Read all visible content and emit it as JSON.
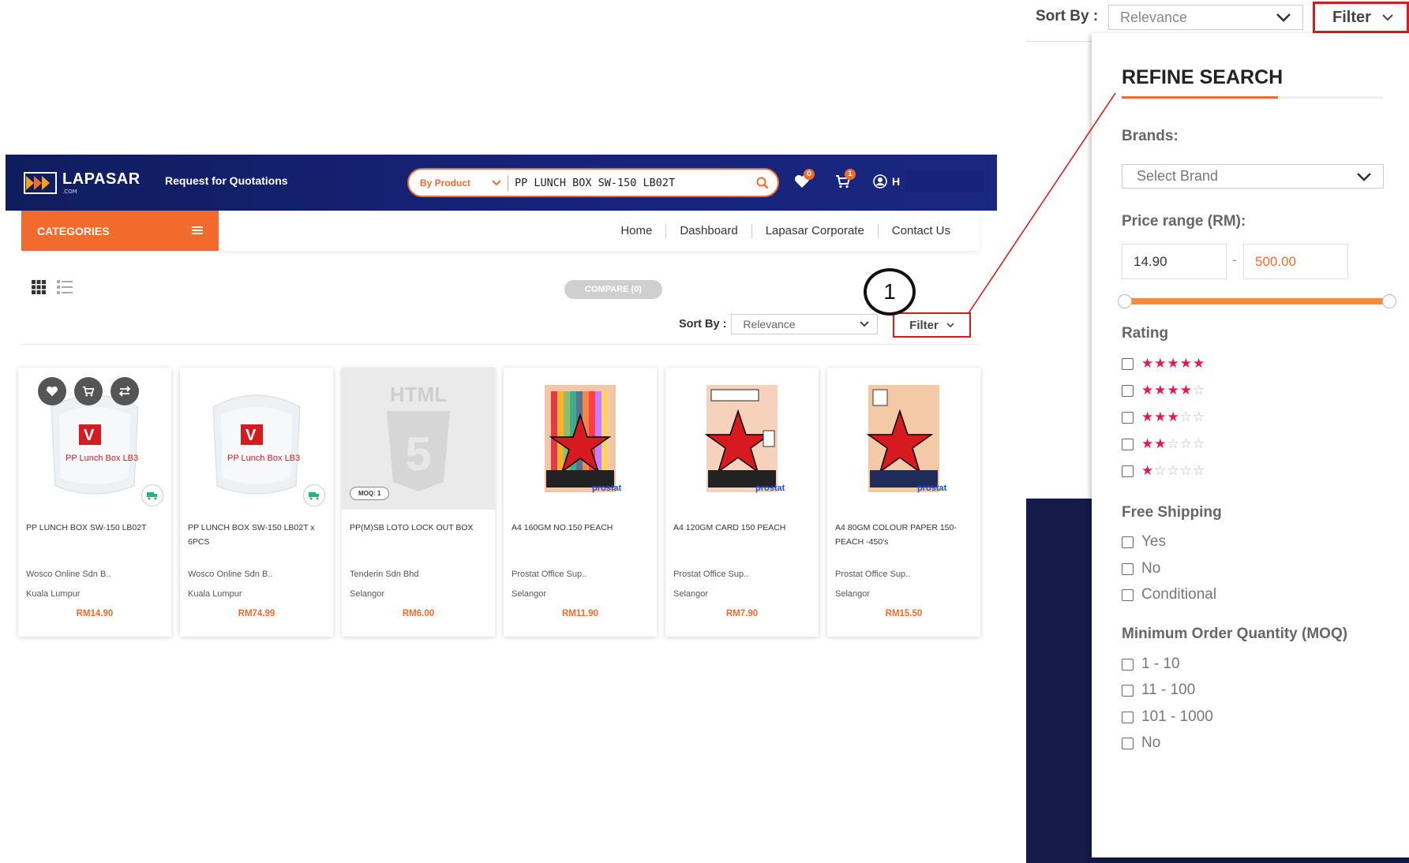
{
  "header": {
    "logo_text": "LAPASAR",
    "logo_sub": ".COM",
    "rfq_link": "Request for Quotations",
    "search_scope": "By Product",
    "search_value": "PP LUNCH BOX SW-150 LB02T",
    "wishlist_count": "0",
    "cart_count": "1",
    "user_initial": "H"
  },
  "nav": {
    "categories_label": "CATEGORIES",
    "links": [
      "Home",
      "Dashboard",
      "Lapasar Corporate",
      "Contact Us"
    ]
  },
  "toolbar": {
    "compare_label": "COMPARE (0)",
    "sort_label": "Sort By :",
    "sort_value": "Relevance",
    "filter_label": "Filter",
    "callout_number": "1"
  },
  "products": [
    {
      "name": "PP LUNCH BOX SW-150 LB02T",
      "seller": "Wosco Online Sdn B..",
      "location": "Kuala Lumpur",
      "price": "RM14.90"
    },
    {
      "name": "PP LUNCH BOX SW-150 LB02T x 6PCS",
      "seller": "Wosco Online Sdn B..",
      "location": "Kuala Lumpur",
      "price": "RM74.99"
    },
    {
      "name": "PP(M)SB LOTO LOCK OUT BOX",
      "seller": "Tenderin Sdn Bhd",
      "location": "Selangor",
      "price": "RM6.00",
      "moq": "MOQ: 1",
      "placeholder_text": "HTML"
    },
    {
      "name": "A4 160GM NO.150 PEACH",
      "seller": "Prostat Office Sup..",
      "location": "Selangor",
      "price": "RM11.90"
    },
    {
      "name": "A4 120GM CARD 150 PEACH",
      "seller": "Prostat Office Sup..",
      "location": "Selangor",
      "price": "RM7.90"
    },
    {
      "name": "A4 80GM COLOUR PAPER 150-PEACH -450's",
      "seller": "Prostat Office Sup..",
      "location": "Selangor",
      "price": "RM15.50"
    }
  ],
  "refine": {
    "sort_label": "Sort By :",
    "sort_value": "Relevance",
    "filter_label": "Filter",
    "title": "REFINE SEARCH",
    "brands_label": "Brands:",
    "brand_placeholder": "Select Brand",
    "price_label": "Price range (RM):",
    "price_min": "14.90",
    "price_max": "500.00",
    "price_sep": "-",
    "rating_label": "Rating",
    "ratings": [
      5,
      4,
      3,
      2,
      1
    ],
    "shipping_label": "Free Shipping",
    "shipping_options": [
      "Yes",
      "No",
      "Conditional"
    ],
    "moq_label": "Minimum Order Quantity (MOQ)",
    "moq_options": [
      "1 - 10",
      "11 - 100",
      "101 - 1000",
      "No"
    ]
  },
  "colors": {
    "brand_orange": "#f26b2c",
    "nav_navy": "#17237a",
    "highlight_red": "#d71920",
    "star_red": "#e6194b"
  }
}
